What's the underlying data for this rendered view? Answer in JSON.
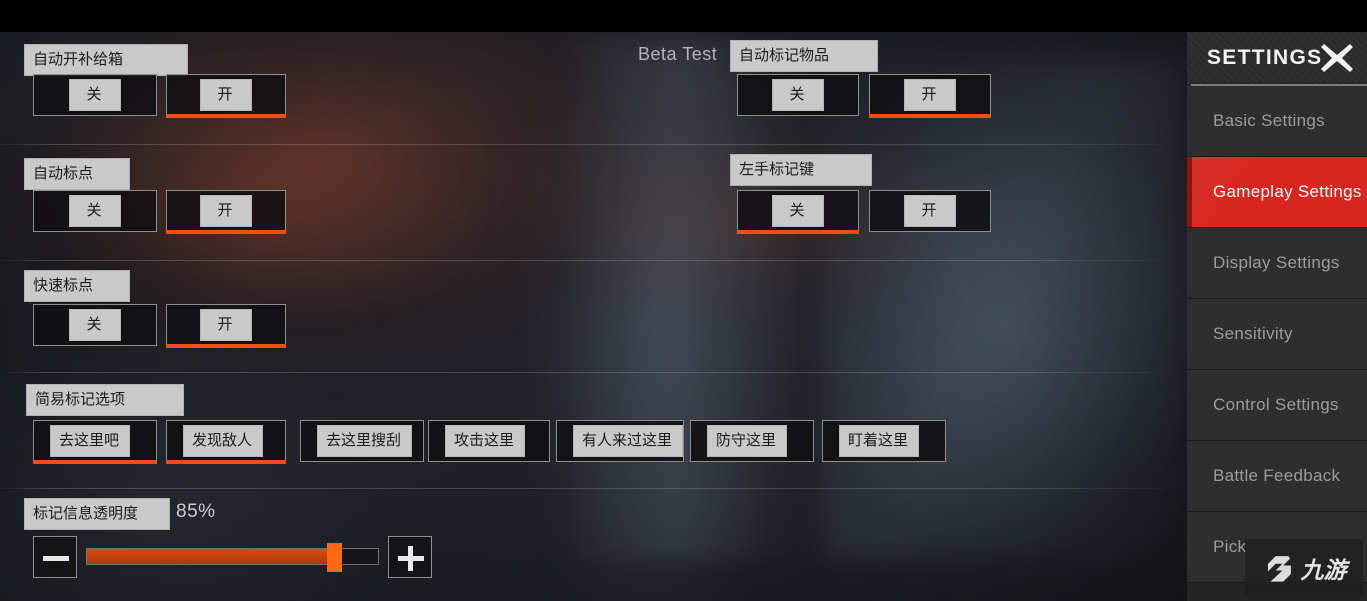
{
  "sidebar": {
    "title": "SETTINGS",
    "close_icon": "close-x-icon",
    "accent_active": "#d8251f",
    "items": [
      {
        "label": "Basic Settings",
        "active": false
      },
      {
        "label": "Gameplay Settings",
        "active": true
      },
      {
        "label": "Display Settings",
        "active": false
      },
      {
        "label": "Sensitivity",
        "active": false
      },
      {
        "label": "Control Settings",
        "active": false
      },
      {
        "label": "Battle Feedback",
        "active": false
      },
      {
        "label": "Pick",
        "active": false
      }
    ]
  },
  "beta_label": "Beta Test",
  "accent_orange": "#f04e12",
  "settings": {
    "auto_open_supply": {
      "label": "自动开补给箱",
      "options": [
        "关",
        "开"
      ],
      "selected": "开"
    },
    "auto_mark_item": {
      "label": "自动标记物品",
      "options": [
        "关",
        "开"
      ],
      "selected": "开"
    },
    "auto_ping": {
      "label": "自动标点",
      "options": [
        "关",
        "开"
      ],
      "selected": "开"
    },
    "left_hand_mark_key": {
      "label": "左手标记键",
      "options": [
        "关",
        "开"
      ],
      "selected": "关"
    },
    "quick_ping": {
      "label": "快速标点",
      "options": [
        "关",
        "开"
      ],
      "selected": "开"
    },
    "simple_mark_options": {
      "label": "简易标记选项",
      "options": [
        {
          "label": "去这里吧",
          "selected": true
        },
        {
          "label": "发现敌人",
          "selected": true
        },
        {
          "label": "去这里搜刮",
          "selected": false
        },
        {
          "label": "攻击这里",
          "selected": false
        },
        {
          "label": "有人来过这里",
          "selected": false
        },
        {
          "label": "防守这里",
          "selected": false
        },
        {
          "label": "盯着这里",
          "selected": false
        }
      ]
    },
    "mark_info_opacity": {
      "label": "标记信息透明度",
      "value_text": "85%",
      "value": 85,
      "min": 0,
      "max": 100,
      "decrease_icon": "minus-icon",
      "increase_icon": "plus-icon"
    }
  },
  "watermark": {
    "text": "九游",
    "icon": "jiuyou-logo-icon"
  }
}
